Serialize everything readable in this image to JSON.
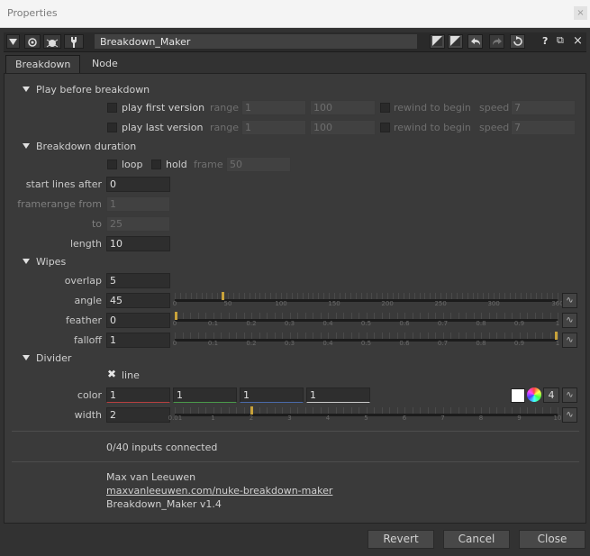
{
  "window": {
    "title": "Properties",
    "close_glyph": "×"
  },
  "header": {
    "node_name": "Breakdown_Maker",
    "tool_help": "?",
    "float_glyph": "⧉",
    "close_glyph": "×"
  },
  "tabs": [
    "Breakdown",
    "Node"
  ],
  "sections": {
    "play": "Play before breakdown",
    "duration": "Breakdown duration",
    "wipes": "Wipes",
    "divider": "Divider"
  },
  "play_first": {
    "label": "play first version",
    "range_label": "range",
    "range_start": "1",
    "range_end": "100",
    "rewind_label": "rewind to begin",
    "speed_label": "speed",
    "speed": "7"
  },
  "play_last": {
    "label": "play last version",
    "range_label": "range",
    "range_start": "1",
    "range_end": "100",
    "rewind_label": "rewind to begin",
    "speed_label": "speed",
    "speed": "7"
  },
  "duration": {
    "loop_label": "loop",
    "hold_label": "hold",
    "frame_label": "frame",
    "frame": "50",
    "start_label": "start lines after",
    "start": "0",
    "framerange_label": "framerange from",
    "framerange_from": "1",
    "to_label": "to",
    "to": "25",
    "length_label": "length",
    "length": "10"
  },
  "wipes": {
    "overlap_label": "overlap",
    "overlap": "5",
    "angle_label": "angle",
    "angle": "45",
    "angle_value": 45,
    "angle_ticks": [
      "0",
      "50",
      "100",
      "150",
      "200",
      "250",
      "300",
      "360"
    ],
    "feather_label": "feather",
    "feather": "0",
    "feather_value": 0,
    "falloff_label": "falloff",
    "falloff": "1",
    "falloff_value": 1,
    "unit_ticks": [
      "0",
      "0.1",
      "0.2",
      "0.3",
      "0.4",
      "0.5",
      "0.6",
      "0.7",
      "0.8",
      "0.9",
      "1"
    ]
  },
  "divider": {
    "line_label": "line",
    "line_checked": "✖",
    "color_label": "color",
    "color": [
      "1",
      "1",
      "1",
      "1"
    ],
    "channels_count": "4",
    "channel_colors": [
      "#b84040",
      "#4a9a4a",
      "#4a6aaa",
      "#c8c8c8"
    ],
    "width_label": "width",
    "width": "2",
    "width_value": 2,
    "width_ticks": [
      "0.01",
      "1",
      "2",
      "3",
      "4",
      "5",
      "6",
      "7",
      "8",
      "9",
      "10"
    ]
  },
  "inputs_connected": "0/40 inputs connected",
  "credits": {
    "author": "Max van Leeuwen",
    "url": "maxvanleeuwen.com/nuke-breakdown-maker",
    "version": "Breakdown_Maker v1.4"
  },
  "buttons": {
    "revert": "Revert",
    "cancel": "Cancel",
    "close": "Close"
  },
  "curve_icon": "∿",
  "colors": {
    "handle": "#c8a23a",
    "panel": "#3a3a3a"
  }
}
